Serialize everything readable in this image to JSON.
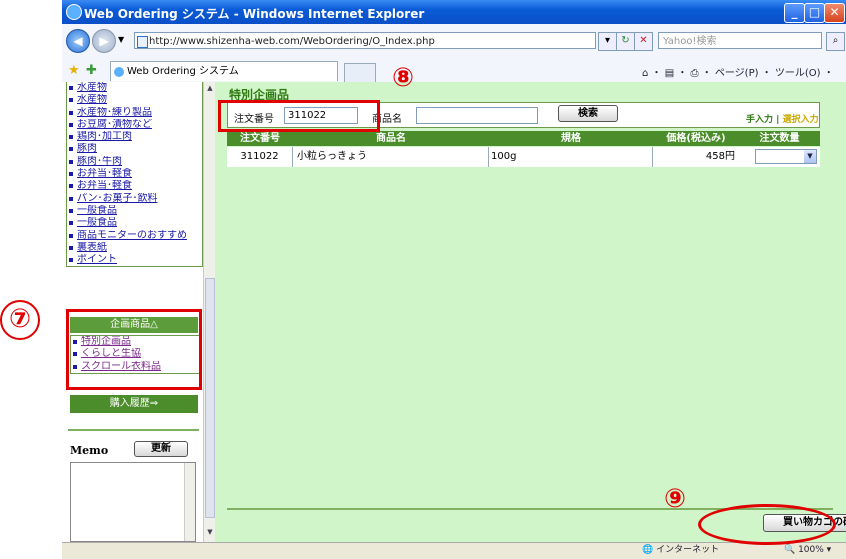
{
  "window": {
    "title": "Web Ordering システム - Windows Internet Explorer",
    "address": "http://www.shizenha-web.com/WebOrdering/O_Index.php",
    "search_placeholder": "Yahoo!検索",
    "tab_title": "Web Ordering システム",
    "toolbar": "ページ(P) ・ ツール(O) ・"
  },
  "sidebar": {
    "items": [
      "水産物",
      "水産物",
      "水産物･練り製品",
      "お豆腐･漬物など",
      "鶏肉･加工肉",
      "豚肉",
      "豚肉･牛肉",
      "お弁当･軽食",
      "お弁当･軽食",
      "パン･お菓子･飲料",
      "一般食品",
      "一般食品",
      "商品モニターのおすすめ",
      "裏表紙",
      "ポイント"
    ],
    "plan_header": "企画商品△",
    "plan_items": [
      "特別企画品",
      "くらしと生協",
      "スクロール衣料品"
    ],
    "history_button": "購入履歴⇒",
    "memo_label": "Memo",
    "memo_update": "更新"
  },
  "main": {
    "title": "特別企画品",
    "order_no_label": "注文番号",
    "order_no_value": "311022",
    "product_name_label": "商品名",
    "product_name_value": "",
    "search_button": "検索",
    "mode_manual": "手入力",
    "mode_sep": "|",
    "mode_select": "選択入力",
    "columns": [
      "注文番号",
      "商品名",
      "規格",
      "価格(税込み)",
      "注文数量"
    ],
    "rows": [
      {
        "order_no": "311022",
        "name": "小粒らっきょう",
        "spec": "100g",
        "price": "458円",
        "qty": ""
      }
    ],
    "cart_button": "買い物カゴの確認"
  },
  "status": {
    "zone": "インターネット",
    "zoom": "100%"
  },
  "annotations": {
    "n7": "⑦",
    "n8": "⑧",
    "n9": "⑨"
  },
  "colors": {
    "accent_green": "#4a8d2a",
    "main_bg": "#CFF5C8",
    "annotation_red": "#e00000"
  }
}
